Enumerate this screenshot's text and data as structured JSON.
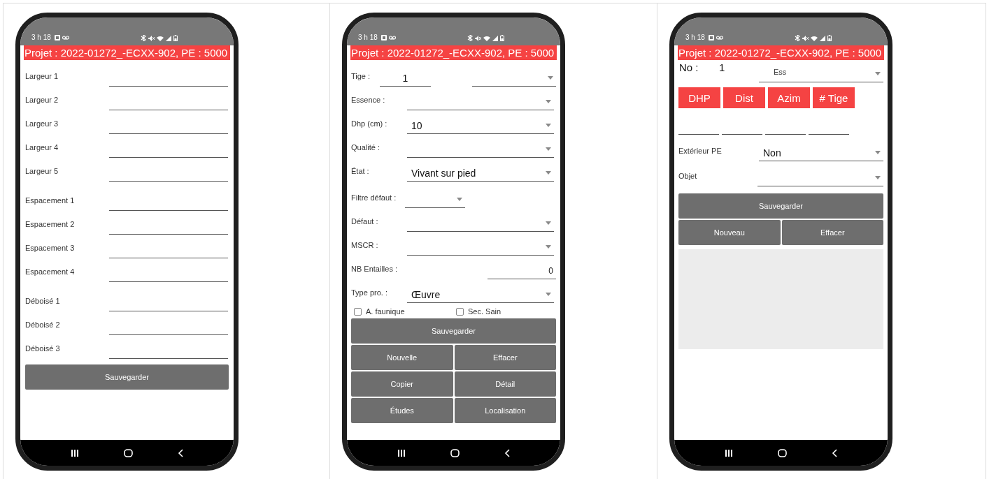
{
  "screens": [
    {
      "status": {
        "time": "3 h 18"
      },
      "header": "Projet : 2022-01272_-ECXX-902, PE : 5000",
      "blocks": [
        {
          "kind": "fields",
          "items": [
            {
              "kind": "input",
              "label": "Largeur 1"
            },
            {
              "kind": "input",
              "label": "Largeur 2"
            },
            {
              "kind": "input",
              "label": "Largeur 3"
            },
            {
              "kind": "input",
              "label": "Largeur 4"
            },
            {
              "kind": "input",
              "label": "Largeur 5"
            }
          ]
        },
        {
          "kind": "fields",
          "items": [
            {
              "kind": "input",
              "label": "Espacement 1"
            },
            {
              "kind": "input",
              "label": "Espacement 2"
            },
            {
              "kind": "input",
              "label": "Espacement 3"
            },
            {
              "kind": "input",
              "label": "Espacement 4"
            }
          ]
        },
        {
          "kind": "fields",
          "items": [
            {
              "kind": "input",
              "label": "Déboisé 1"
            },
            {
              "kind": "input",
              "label": "Déboisé 2"
            },
            {
              "kind": "input",
              "label": "Déboisé 3"
            }
          ]
        },
        {
          "kind": "buttons",
          "rows": [
            [
              "Sauvegarder"
            ]
          ]
        }
      ]
    },
    {
      "status": {
        "time": "3 h 18"
      },
      "header": "Projet : 2022-01272_-ECXX-902, PE : 5000",
      "blocks": [
        {
          "kind": "fields",
          "items": [
            {
              "kind": "input_dropdown",
              "label": "Tige :",
              "value": "1"
            },
            {
              "kind": "dropdown",
              "label": "Essence :"
            },
            {
              "kind": "dropdown",
              "label": "Dhp (cm) :",
              "value": "10"
            },
            {
              "kind": "dropdown",
              "label": "Qualité :"
            },
            {
              "kind": "dropdown",
              "label": "État :",
              "value": "Vivant sur pied"
            },
            {
              "kind": "short_dropdown",
              "label": "Filtre défaut :"
            },
            {
              "kind": "dropdown",
              "label": "Défaut :"
            },
            {
              "kind": "dropdown",
              "label": "MSCR :"
            },
            {
              "kind": "number",
              "label": "NB Entailles :",
              "value": "0"
            },
            {
              "kind": "dropdown",
              "label": "Type pro. :",
              "value": "Œuvre"
            }
          ]
        },
        {
          "kind": "checks",
          "items": [
            {
              "label": "A. faunique",
              "checked": false
            },
            {
              "label": "Sec. Sain",
              "checked": false
            }
          ]
        },
        {
          "kind": "buttons",
          "rows": [
            [
              "Sauvegarder"
            ],
            [
              "Nouvelle",
              "Effacer"
            ],
            [
              "Copier",
              "Détail"
            ],
            [
              "Études",
              "Localisation"
            ]
          ]
        }
      ]
    },
    {
      "status": {
        "time": "3 h 18"
      },
      "header": "Projet : 2022-01272_-ECXX-902, PE : 5000",
      "blocks": [
        {
          "kind": "id_row",
          "label": "No :",
          "value": "1",
          "dropdown_label": "Ess"
        },
        {
          "kind": "measures",
          "items": [
            {
              "label": "DHP"
            },
            {
              "label": "Dist"
            },
            {
              "label": "Azim"
            },
            {
              "label": "# Tige"
            }
          ]
        },
        {
          "kind": "fields",
          "items": [
            {
              "kind": "dropdown",
              "label": "Extérieur PE",
              "value": "Non"
            },
            {
              "kind": "dropdown",
              "label": "Objet"
            }
          ]
        },
        {
          "kind": "buttons",
          "rows": [
            [
              "Sauvegarder"
            ],
            [
              "Nouveau",
              "Effacer"
            ]
          ]
        },
        {
          "kind": "list_area"
        }
      ]
    }
  ]
}
